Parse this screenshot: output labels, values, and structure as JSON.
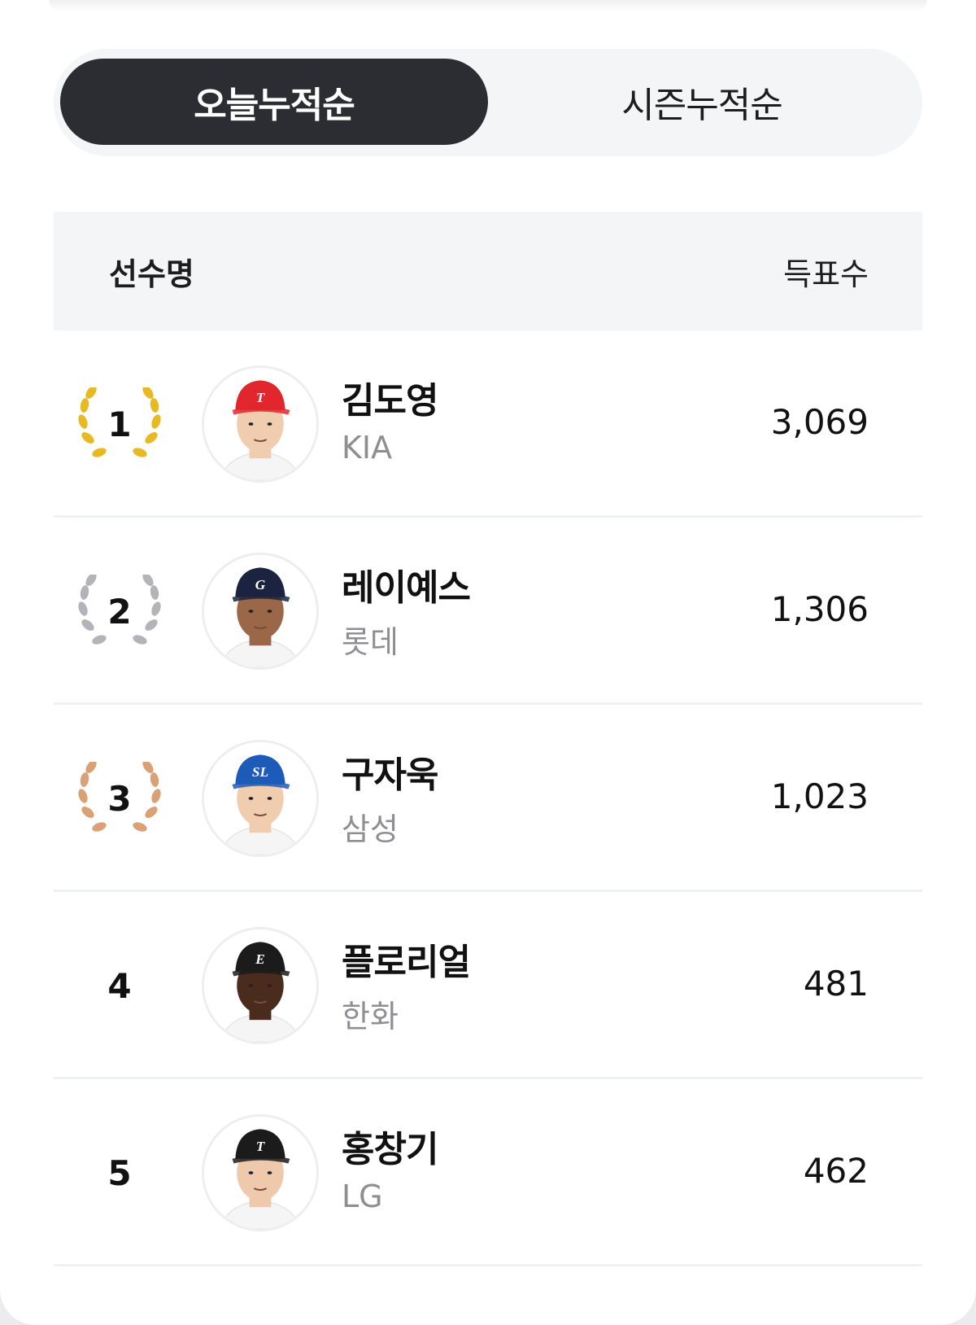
{
  "tabs": [
    {
      "label": "오늘누적순",
      "active": true
    },
    {
      "label": "시즌누적순",
      "active": false
    }
  ],
  "table": {
    "header": {
      "name": "선수명",
      "votes": "득표수"
    },
    "rows": [
      {
        "rank": "1",
        "name": "김도영",
        "team": "KIA",
        "votes": "3,069",
        "laurel": "gold",
        "laurel_color": "#e8b923",
        "cap_color": "#e1262d",
        "cap_logo": "T",
        "skin": "#f1cdb0"
      },
      {
        "rank": "2",
        "name": "레이예스",
        "team": "롯데",
        "votes": "1,306",
        "laurel": "silver",
        "laurel_color": "#b4b4b8",
        "cap_color": "#1c2340",
        "cap_logo": "G",
        "skin": "#9a6848"
      },
      {
        "rank": "3",
        "name": "구자욱",
        "team": "삼성",
        "votes": "1,023",
        "laurel": "bronze",
        "laurel_color": "#d9a175",
        "cap_color": "#1e5ab8",
        "cap_logo": "SL",
        "skin": "#f1cdb0"
      },
      {
        "rank": "4",
        "name": "플로리얼",
        "team": "한화",
        "votes": "481",
        "laurel": "none",
        "laurel_color": "",
        "cap_color": "#1b1b1b",
        "cap_logo": "E",
        "skin": "#4a2c1e"
      },
      {
        "rank": "5",
        "name": "홍창기",
        "team": "LG",
        "votes": "462",
        "laurel": "none",
        "laurel_color": "",
        "cap_color": "#1b1b1b",
        "cap_logo": "T",
        "skin": "#efc9ab"
      }
    ]
  }
}
